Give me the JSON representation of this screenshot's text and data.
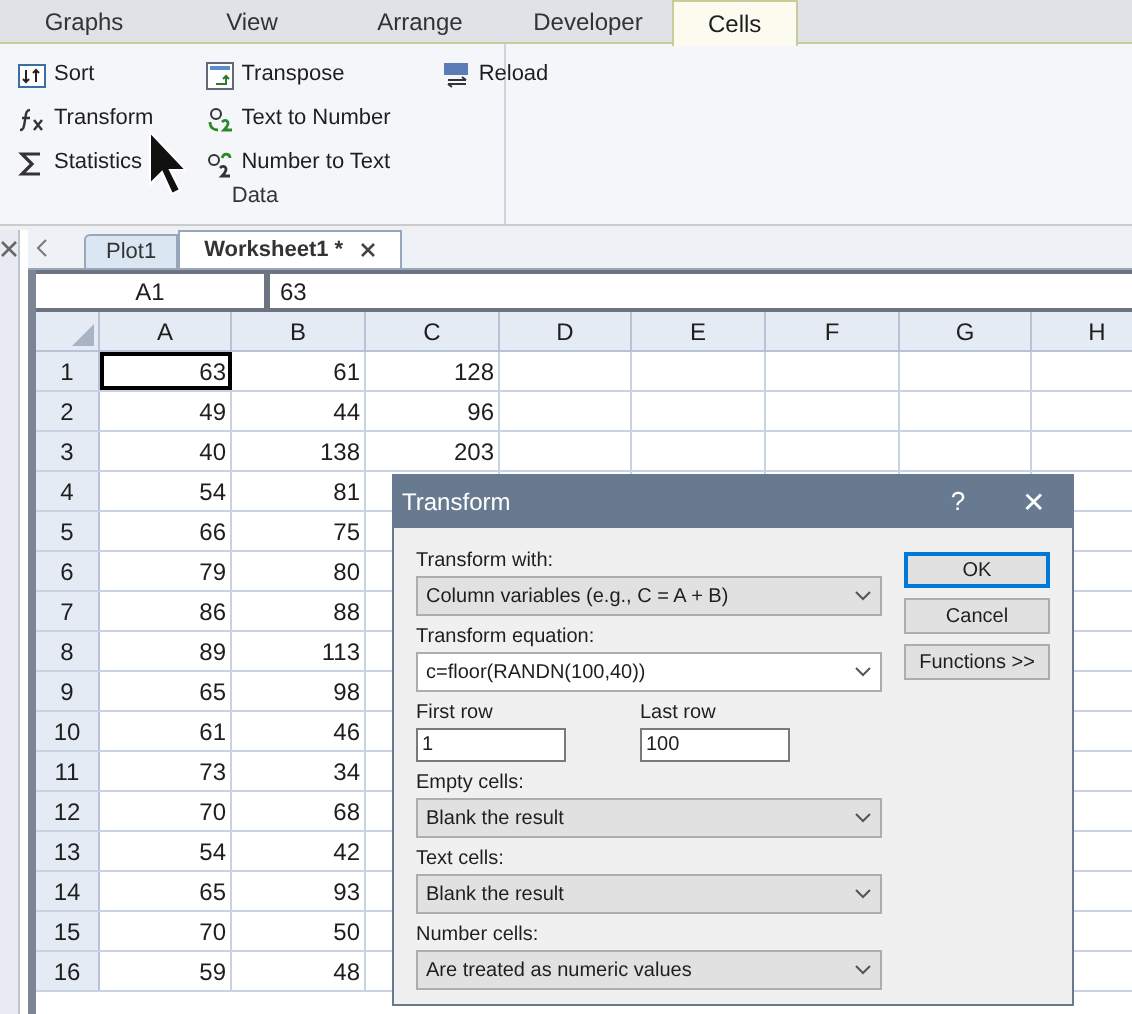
{
  "ribbon_tabs": [
    {
      "label": "Graphs",
      "selected": false
    },
    {
      "label": "View",
      "selected": false
    },
    {
      "label": "Arrange",
      "selected": false
    },
    {
      "label": "Developer",
      "selected": false
    },
    {
      "label": "Cells",
      "selected": true
    }
  ],
  "ribbon_groups": [
    {
      "label": "Data",
      "columns": [
        [
          {
            "kind": "sort",
            "label": "Sort"
          },
          {
            "kind": "fx",
            "label": "Transform"
          },
          {
            "kind": "sigma",
            "label": "Statistics"
          }
        ],
        [
          {
            "kind": "transpose",
            "label": "Transpose"
          },
          {
            "kind": "t2n",
            "label": "Text to Number"
          },
          {
            "kind": "n2t",
            "label": "Number to Text"
          }
        ],
        [
          {
            "kind": "reload",
            "label": "Reload"
          }
        ]
      ]
    }
  ],
  "doc_tabs": [
    {
      "label": "Plot1",
      "selected": false
    },
    {
      "label": "Worksheet1 *",
      "selected": true
    }
  ],
  "formula_bar": {
    "cell": "A1",
    "value": "63"
  },
  "table": {
    "columns": [
      "A",
      "B",
      "C",
      "D",
      "E",
      "F",
      "G",
      "H"
    ],
    "rows": [
      {
        "number": "1",
        "cells": [
          "63",
          "61",
          "128"
        ]
      },
      {
        "number": "2",
        "cells": [
          "49",
          "44",
          "96"
        ]
      },
      {
        "number": "3",
        "cells": [
          "40",
          "138",
          "203"
        ]
      },
      {
        "number": "4",
        "cells": [
          "54",
          "81"
        ]
      },
      {
        "number": "5",
        "cells": [
          "66",
          "75"
        ]
      },
      {
        "number": "6",
        "cells": [
          "79",
          "80"
        ]
      },
      {
        "number": "7",
        "cells": [
          "86",
          "88"
        ]
      },
      {
        "number": "8",
        "cells": [
          "89",
          "113"
        ]
      },
      {
        "number": "9",
        "cells": [
          "65",
          "98"
        ]
      },
      {
        "number": "10",
        "cells": [
          "61",
          "46"
        ]
      },
      {
        "number": "11",
        "cells": [
          "73",
          "34"
        ]
      },
      {
        "number": "12",
        "cells": [
          "70",
          "68"
        ]
      },
      {
        "number": "13",
        "cells": [
          "54",
          "42"
        ]
      },
      {
        "number": "14",
        "cells": [
          "65",
          "93"
        ]
      },
      {
        "number": "15",
        "cells": [
          "70",
          "50"
        ]
      },
      {
        "number": "16",
        "cells": [
          "59",
          "48"
        ]
      }
    ]
  },
  "dialog": {
    "title": "Transform",
    "help": "?",
    "close": "✕",
    "fields": [
      {
        "kind": "select",
        "label": "Transform with:",
        "value": "Column variables (e.g., C = A + B)"
      },
      {
        "kind": "combo",
        "label": "Transform equation:",
        "value": "c=floor(RANDN(100,40))"
      },
      {
        "kind": "pair",
        "items": [
          {
            "label": "First row",
            "value": "1"
          },
          {
            "label": "Last row",
            "value": "100"
          }
        ]
      },
      {
        "kind": "select",
        "label": "Empty cells:",
        "value": "Blank the result"
      },
      {
        "kind": "select",
        "label": "Text cells:",
        "value": "Blank the result"
      },
      {
        "kind": "select",
        "label": "Number cells:",
        "value": "Are treated as numeric values"
      }
    ],
    "buttons": [
      {
        "label": "OK",
        "default": true
      },
      {
        "label": "Cancel",
        "default": false
      },
      {
        "label": "Functions >>",
        "default": false
      }
    ]
  }
}
